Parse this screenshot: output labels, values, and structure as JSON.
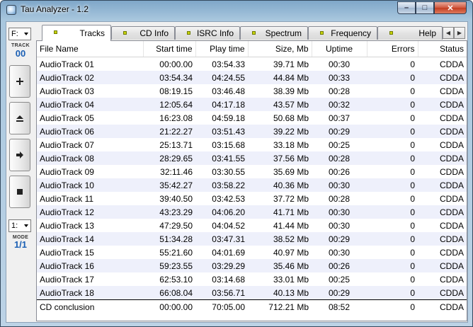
{
  "window": {
    "title": "Tau Analyzer - 1.2"
  },
  "controls": {
    "minimize": "–",
    "maximize": "□",
    "close": "✕"
  },
  "sidebar": {
    "drive": "F:",
    "track_label": "TRACK",
    "track_value": "00",
    "mode_select": "1:",
    "mode_label": "MODE",
    "mode_value": "1/1",
    "buttons": [
      {
        "name": "add-button",
        "icon": "plus-icon",
        "glyph": "+"
      },
      {
        "name": "eject-button",
        "icon": "eject-icon",
        "glyph": "⏏"
      },
      {
        "name": "play-button",
        "icon": "arrow-right-icon",
        "glyph": "➜"
      },
      {
        "name": "stop-button",
        "icon": "stop-icon",
        "glyph": "■"
      }
    ]
  },
  "tabs": [
    {
      "label": "Tracks",
      "active": true
    },
    {
      "label": "CD Info",
      "active": false
    },
    {
      "label": "ISRC Info",
      "active": false
    },
    {
      "label": "Spectrum",
      "active": false
    },
    {
      "label": "Frequency",
      "active": false
    },
    {
      "label": "Help",
      "active": false
    }
  ],
  "table": {
    "columns": [
      "File Name",
      "Start time",
      "Play time",
      "Size, Mb",
      "Uptime",
      "Errors",
      "Status"
    ],
    "rows": [
      [
        "AudioTrack 01",
        "00:00.00",
        "03:54.33",
        "39.71 Mb",
        "00:30",
        "0",
        "CDDA"
      ],
      [
        "AudioTrack 02",
        "03:54.34",
        "04:24.55",
        "44.84 Mb",
        "00:33",
        "0",
        "CDDA"
      ],
      [
        "AudioTrack 03",
        "08:19.15",
        "03:46.48",
        "38.39 Mb",
        "00:28",
        "0",
        "CDDA"
      ],
      [
        "AudioTrack 04",
        "12:05.64",
        "04:17.18",
        "43.57 Mb",
        "00:32",
        "0",
        "CDDA"
      ],
      [
        "AudioTrack 05",
        "16:23.08",
        "04:59.18",
        "50.68 Mb",
        "00:37",
        "0",
        "CDDA"
      ],
      [
        "AudioTrack 06",
        "21:22.27",
        "03:51.43",
        "39.22 Mb",
        "00:29",
        "0",
        "CDDA"
      ],
      [
        "AudioTrack 07",
        "25:13.71",
        "03:15.68",
        "33.18 Mb",
        "00:25",
        "0",
        "CDDA"
      ],
      [
        "AudioTrack 08",
        "28:29.65",
        "03:41.55",
        "37.56 Mb",
        "00:28",
        "0",
        "CDDA"
      ],
      [
        "AudioTrack 09",
        "32:11.46",
        "03:30.55",
        "35.69 Mb",
        "00:26",
        "0",
        "CDDA"
      ],
      [
        "AudioTrack 10",
        "35:42.27",
        "03:58.22",
        "40.36 Mb",
        "00:30",
        "0",
        "CDDA"
      ],
      [
        "AudioTrack 11",
        "39:40.50",
        "03:42.53",
        "37.72 Mb",
        "00:28",
        "0",
        "CDDA"
      ],
      [
        "AudioTrack 12",
        "43:23.29",
        "04:06.20",
        "41.71 Mb",
        "00:30",
        "0",
        "CDDA"
      ],
      [
        "AudioTrack 13",
        "47:29.50",
        "04:04.52",
        "41.44 Mb",
        "00:30",
        "0",
        "CDDA"
      ],
      [
        "AudioTrack 14",
        "51:34.28",
        "03:47.31",
        "38.52 Mb",
        "00:29",
        "0",
        "CDDA"
      ],
      [
        "AudioTrack 15",
        "55:21.60",
        "04:01.69",
        "40.97 Mb",
        "00:30",
        "0",
        "CDDA"
      ],
      [
        "AudioTrack 16",
        "59:23.55",
        "03:29.29",
        "35.46 Mb",
        "00:26",
        "0",
        "CDDA"
      ],
      [
        "AudioTrack 17",
        "62:53.10",
        "03:14.68",
        "33.01 Mb",
        "00:25",
        "0",
        "CDDA"
      ],
      [
        "AudioTrack 18",
        "66:08.04",
        "03:56.71",
        "40.13 Mb",
        "00:29",
        "0",
        "CDDA"
      ]
    ],
    "summary": [
      "CD conclusion",
      "00:00.00",
      "70:05.00",
      "712.21 Mb",
      "08:52",
      "0",
      "CDDA"
    ]
  },
  "colors": {
    "tab_led": "#c8d400",
    "info_blue": "#1a5fb4",
    "row_alt": "#eef0fb"
  }
}
